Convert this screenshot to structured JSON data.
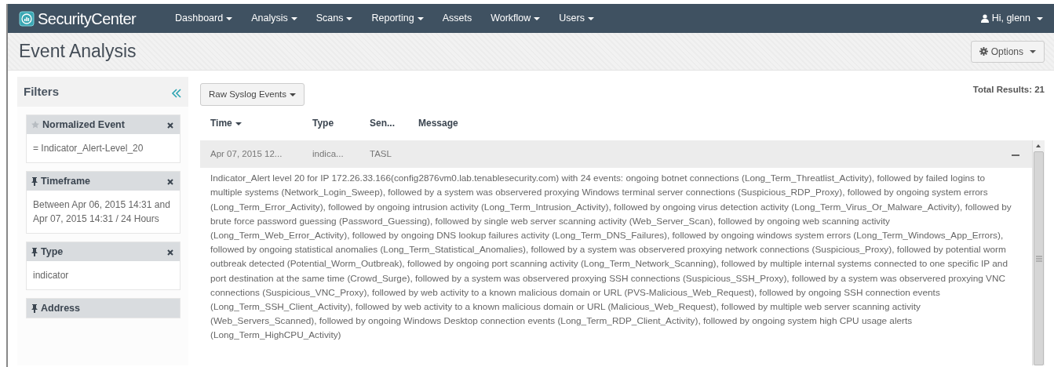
{
  "navbar": {
    "brand": "SecurityCenter",
    "items": [
      {
        "label": "Dashboard",
        "dropdown": true
      },
      {
        "label": "Analysis",
        "dropdown": true
      },
      {
        "label": "Scans",
        "dropdown": true
      },
      {
        "label": "Reporting",
        "dropdown": true
      },
      {
        "label": "Assets",
        "dropdown": false
      },
      {
        "label": "Workflow",
        "dropdown": true
      },
      {
        "label": "Users",
        "dropdown": true
      }
    ],
    "user": {
      "label": "Hi, glenn",
      "dropdown": true
    }
  },
  "page": {
    "title": "Event Analysis",
    "options_button": "Options"
  },
  "filters": {
    "title": "Filters",
    "items": [
      {
        "kind": "star",
        "label": "Normalized Event",
        "removable": true,
        "value": "= Indicator_Alert-Level_20"
      },
      {
        "kind": "pin",
        "label": "Timeframe",
        "removable": true,
        "value": "Between Apr 06, 2015 14:31 and Apr 07, 2015 14:31 / 24 Hours"
      },
      {
        "kind": "pin",
        "label": "Type",
        "removable": true,
        "value": "indicator"
      },
      {
        "kind": "pin",
        "label": "Address",
        "removable": false
      }
    ]
  },
  "results": {
    "view_button": "Raw Syslog Events",
    "total": "Total Results: 21",
    "columns": [
      {
        "label": "Time",
        "sorted": true
      },
      {
        "label": "Type",
        "sorted": false
      },
      {
        "label": "Sen...",
        "sorted": false
      },
      {
        "label": "Message",
        "sorted": false
      }
    ],
    "rows": [
      {
        "time": "Apr 07, 2015 12...",
        "type": "indica...",
        "sensor": "TASL",
        "expanded": true,
        "message": "Indicator_Alert level 20 for IP 172.26.33.166(config2876vm0.lab.tenablesecurity.com) with 24 events: ongoing botnet connections (Long_Term_Threatlist_Activity), followed by failed logins to multiple systems (Network_Login_Sweep), followed by a system was observered proxying Windows terminal server connections (Suspicious_RDP_Proxy), followed by ongoing system errors (Long_Term_Error_Activity), followed by ongoing intrusion activity (Long_Term_Intrusion_Activity), followed by ongoing virus detection activity (Long_Term_Virus_Or_Malware_Activity), followed by brute force password guessing (Password_Guessing), followed by single web server scanning activity (Web_Server_Scan), followed by ongoing web scanning activity (Long_Term_Web_Error_Activity), followed by ongoing DNS lookup failures activity (Long_Term_DNS_Failures), followed by ongoing windows system errors (Long_Term_Windows_App_Errors), followed by ongoing statistical anomalies (Long_Term_Statistical_Anomalies), followed by a system was observered proxying network connections (Suspicious_Proxy), followed by potential worm outbreak detected (Potential_Worm_Outbreak), followed by ongoing port scanning activity (Long_Term_Network_Scanning), followed by multiple internal systems connected to one specific IP and port destination at the same time (Crowd_Surge), followed by a system was observered proxying SSH connections (Suspicious_SSH_Proxy), followed by a system was observered proxying VNC connections (Suspicious_VNC_Proxy), followed by web activity to a known malicious domain or URL (PVS-Malicious_Web_Request), followed by ongoing SSH connection events (Long_Term_SSH_Client_Activity), followed by web activity to a known malicious domain or URL (Malicious_Web_Request), followed by multiple web server scanning activity (Web_Servers_Scanned), followed by ongoing Windows Desktop connection events (Long_Term_RDP_Client_Activity), followed by ongoing system high CPU usage alerts (Long_Term_HighCPU_Activity)"
      }
    ]
  }
}
